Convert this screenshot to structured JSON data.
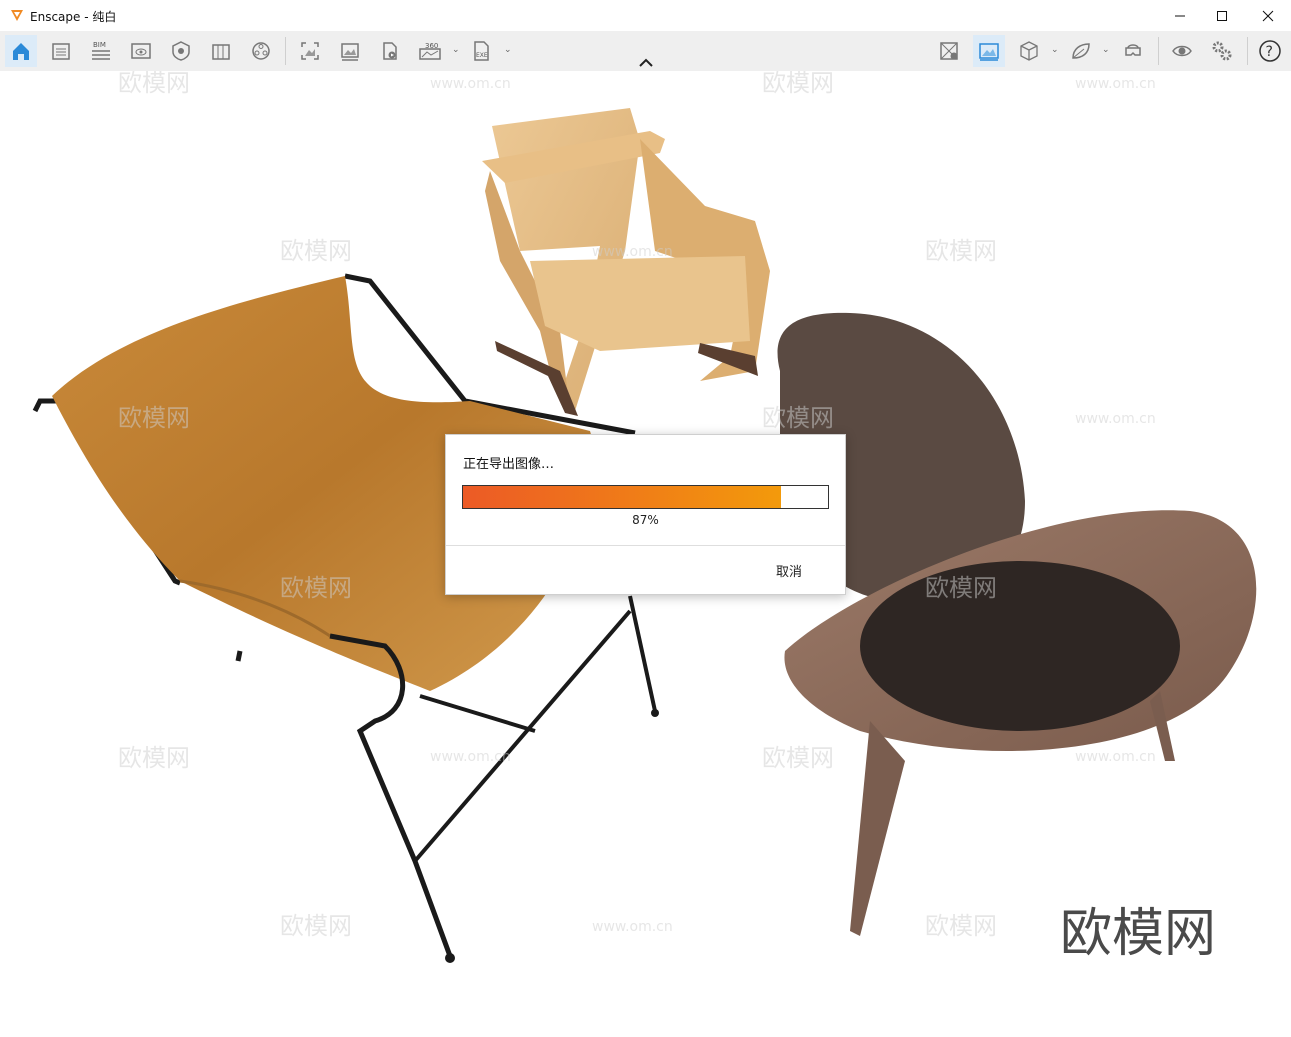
{
  "window": {
    "title": "Enscape - 纯白",
    "accent_color": "#f08a24"
  },
  "toolbar": {
    "left_icons": [
      "home-icon",
      "views-icon",
      "bim-icon",
      "capture-icon",
      "visual-settings-icon",
      "asset-library-icon",
      "material-editor-icon",
      "screenshot-icon",
      "batch-render-icon",
      "video-editor-icon",
      "panorama-icon",
      "exe-export-icon"
    ],
    "right_icons": [
      "site-context-icon",
      "atmosphere-icon",
      "cube-view-icon",
      "feedback-icon",
      "vr-headset-icon",
      "eye-icon",
      "settings-icon",
      "help-icon"
    ],
    "bim_label": "BIM",
    "pano_label": "360",
    "exe_label": "EXE",
    "help_label": "?"
  },
  "watermark": {
    "text": "欧模网",
    "url": "www.om.cn",
    "brand": "欧模网"
  },
  "export_dialog": {
    "title": "正在导出图像…",
    "progress": 0.87,
    "progress_label": "87%",
    "cancel_label": "取消",
    "gradient_start": "#ec5a26",
    "gradient_end": "#f39a0b"
  }
}
